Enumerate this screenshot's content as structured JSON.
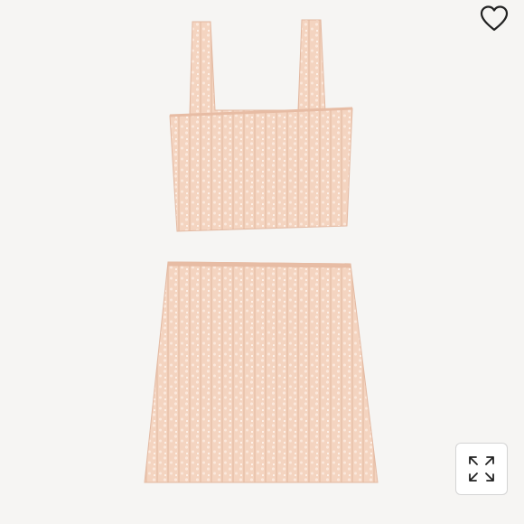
{
  "viewer": {
    "background": "#f6f5f3",
    "product_color": "#f4d4c0",
    "product_shade": "#e9bfa8",
    "product_highlight": "#fbe8dc"
  },
  "favorite_button": {
    "icon": "heart-outline-icon",
    "color": "#222222"
  },
  "expand_button": {
    "icon": "expand-arrows-icon",
    "color": "#222222"
  }
}
